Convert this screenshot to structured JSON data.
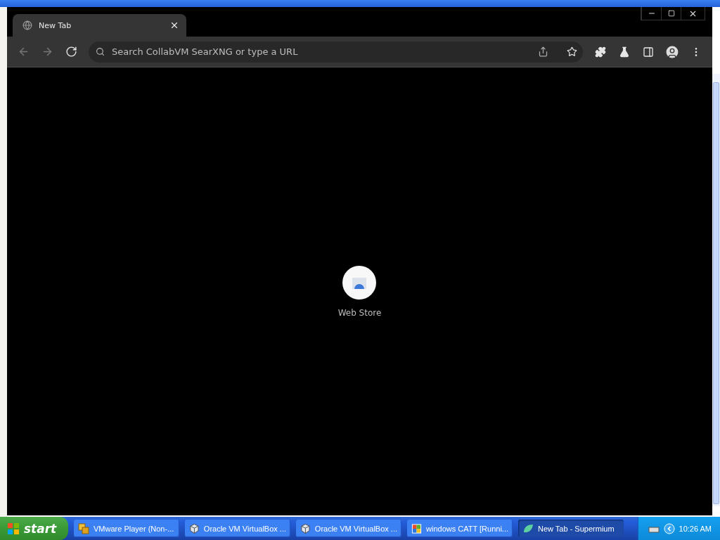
{
  "browser": {
    "tabs": [
      {
        "title": "New Tab",
        "selected": true
      }
    ],
    "nav": [
      {
        "kind": "back",
        "disabled": true
      },
      {
        "kind": "forward",
        "disabled": true
      },
      {
        "kind": "reload",
        "disabled": false
      }
    ],
    "omnibox": {
      "placeholder": "Search CollabVM SearXNG or type a URL"
    },
    "shortcuts": [
      {
        "label": "Web Store"
      }
    ]
  },
  "taskbar": {
    "start": "start",
    "tasks": [
      {
        "label": "VMware Player (Non-...",
        "kind": "vmware",
        "selected": false
      },
      {
        "label": "Oracle VM VirtualBox ...",
        "kind": "virtualbox",
        "selected": false
      },
      {
        "label": "Oracle VM VirtualBox ...",
        "kind": "virtualbox",
        "selected": false
      },
      {
        "label": "windows CATT [Runni...",
        "kind": "catt",
        "selected": false
      },
      {
        "label": "New Tab - Supermium",
        "kind": "browser",
        "selected": true
      }
    ],
    "clock": "10:26 AM"
  }
}
